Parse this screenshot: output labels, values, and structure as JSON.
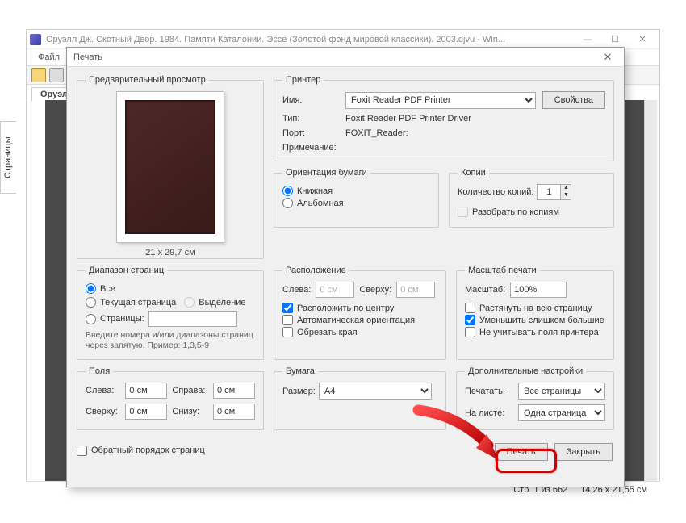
{
  "outer": {
    "title": "Оруэлл Дж. Скотный Двор. 1984. Памяти Каталонии. Эссе (Золотой фонд мировой классики). 2003.djvu - Win...",
    "menu_file": "Файл",
    "tab": "Оруэлл",
    "side": "Страницы"
  },
  "status": {
    "pages": "Стр. 1 из 662",
    "dim": "14,26 x 21,55 см"
  },
  "dialog": {
    "title": "Печать",
    "preview": {
      "legend": "Предварительный просмотр",
      "dim": "21 x 29,7 см"
    },
    "printer": {
      "legend": "Принтер",
      "name_lbl": "Имя:",
      "name_val": "Foxit Reader PDF Printer",
      "props_btn": "Свойства",
      "type_lbl": "Тип:",
      "type_val": "Foxit Reader PDF Printer Driver",
      "port_lbl": "Порт:",
      "port_val": "FOXIT_Reader:",
      "note_lbl": "Примечание:"
    },
    "orient": {
      "legend": "Ориентация бумаги",
      "portrait": "Книжная",
      "landscape": "Альбомная"
    },
    "copies": {
      "legend": "Копии",
      "count_lbl": "Количество копий:",
      "count_val": "1",
      "collate": "Разобрать по копиям"
    },
    "range": {
      "legend": "Диапазон страниц",
      "all": "Все",
      "current": "Текущая страница",
      "selection": "Выделение",
      "pages_lbl": "Страницы:",
      "hint": "Введите номера и/или диапазоны страниц через запятую. Пример: 1,3,5-9"
    },
    "layout": {
      "legend": "Расположение",
      "left": "Слева:",
      "top": "Сверху:",
      "zero": "0 см",
      "center": "Расположить по центру",
      "auto": "Автоматическая ориентация",
      "crop": "Обрезать края"
    },
    "scale": {
      "legend": "Масштаб печати",
      "lbl": "Масштаб:",
      "val": "100%",
      "stretch": "Растянуть на всю страницу",
      "shrink": "Уменьшить слишком большие",
      "ignore": "Не учитывать поля принтера"
    },
    "margins": {
      "legend": "Поля",
      "left": "Слева:",
      "right": "Справа:",
      "top": "Сверху:",
      "bottom": "Снизу:",
      "zero": "0 см"
    },
    "paper": {
      "legend": "Бумага",
      "size_lbl": "Размер:",
      "size_val": "A4"
    },
    "adv": {
      "legend": "Дополнительные настройки",
      "print_lbl": "Печатать:",
      "print_val": "Все страницы",
      "sheet_lbl": "На листе:",
      "sheet_val": "Одна страница"
    },
    "reverse": "Обратный порядок страниц",
    "print_btn": "Печать",
    "close_btn": "Закрыть"
  }
}
